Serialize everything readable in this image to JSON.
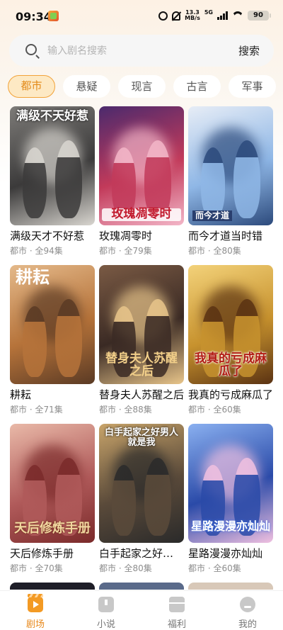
{
  "status_bar": {
    "time": "09:34",
    "speed_value": "13.3",
    "speed_unit": "MB/s",
    "network": "5G",
    "battery": "90"
  },
  "search": {
    "placeholder": "输入剧名搜索",
    "button_label": "搜索"
  },
  "categories": {
    "items": [
      {
        "label": "都市",
        "active": true
      },
      {
        "label": "悬疑",
        "active": false
      },
      {
        "label": "现言",
        "active": false
      },
      {
        "label": "古言",
        "active": false
      },
      {
        "label": "军事",
        "active": false
      }
    ]
  },
  "dramas": [
    {
      "title": "满级天才不好惹",
      "poster_text": "满级不天好惹",
      "meta": "都市 · 全94集",
      "colors": [
        "#3b3a3a",
        "#7d7b78",
        "#d9d6d0"
      ]
    },
    {
      "title": "玫瑰凋零时",
      "poster_text": "玫瑰凋零时",
      "meta": "都市 · 全79集",
      "colors": [
        "#c23a5a",
        "#4b2a6d",
        "#f3b6c8"
      ]
    },
    {
      "title": "而今才道当时错",
      "poster_text": "而今才道",
      "meta": "都市 · 全80集",
      "colors": [
        "#8fb7e6",
        "#e7edf6",
        "#2c4a7c"
      ]
    },
    {
      "title": "耕耘",
      "poster_text": "耕耘",
      "meta": "都市 · 全71集",
      "colors": [
        "#b6733a",
        "#e4b98a",
        "#5a3a24"
      ]
    },
    {
      "title": "替身夫人苏醒之后",
      "poster_text": "替身夫人苏醒之后",
      "meta": "都市 · 全88集",
      "colors": [
        "#3a2a24",
        "#7a5a44",
        "#e8c58a"
      ]
    },
    {
      "title": "我真的亏成麻瓜了",
      "poster_text": "我真的亏成麻瓜了",
      "meta": "都市 · 全60集",
      "colors": [
        "#c7922e",
        "#f3d27a",
        "#5a3212"
      ]
    },
    {
      "title": "天后修炼手册",
      "poster_text": "天后修炼手册",
      "meta": "都市 · 全70集",
      "colors": [
        "#b05a5a",
        "#e9b9a8",
        "#7a2a2a"
      ]
    },
    {
      "title": "白手起家之好男人就是我",
      "poster_text": "白手起家之好男人就是我",
      "meta": "都市 · 全80集",
      "colors": [
        "#5a4a3a",
        "#c8a46a",
        "#2a2a2a"
      ]
    },
    {
      "title": "星路漫漫亦灿灿",
      "poster_text": "星路漫漫亦灿灿",
      "meta": "都市 · 全60集",
      "colors": [
        "#2a4aa8",
        "#8ab0f0",
        "#f0c0e0"
      ]
    }
  ],
  "bottom_nav": {
    "items": [
      {
        "label": "剧场",
        "icon": "theater-icon",
        "active": true
      },
      {
        "label": "小说",
        "icon": "book-icon",
        "active": false
      },
      {
        "label": "福利",
        "icon": "gift-icon",
        "active": false
      },
      {
        "label": "我的",
        "icon": "profile-icon",
        "active": false
      }
    ]
  }
}
